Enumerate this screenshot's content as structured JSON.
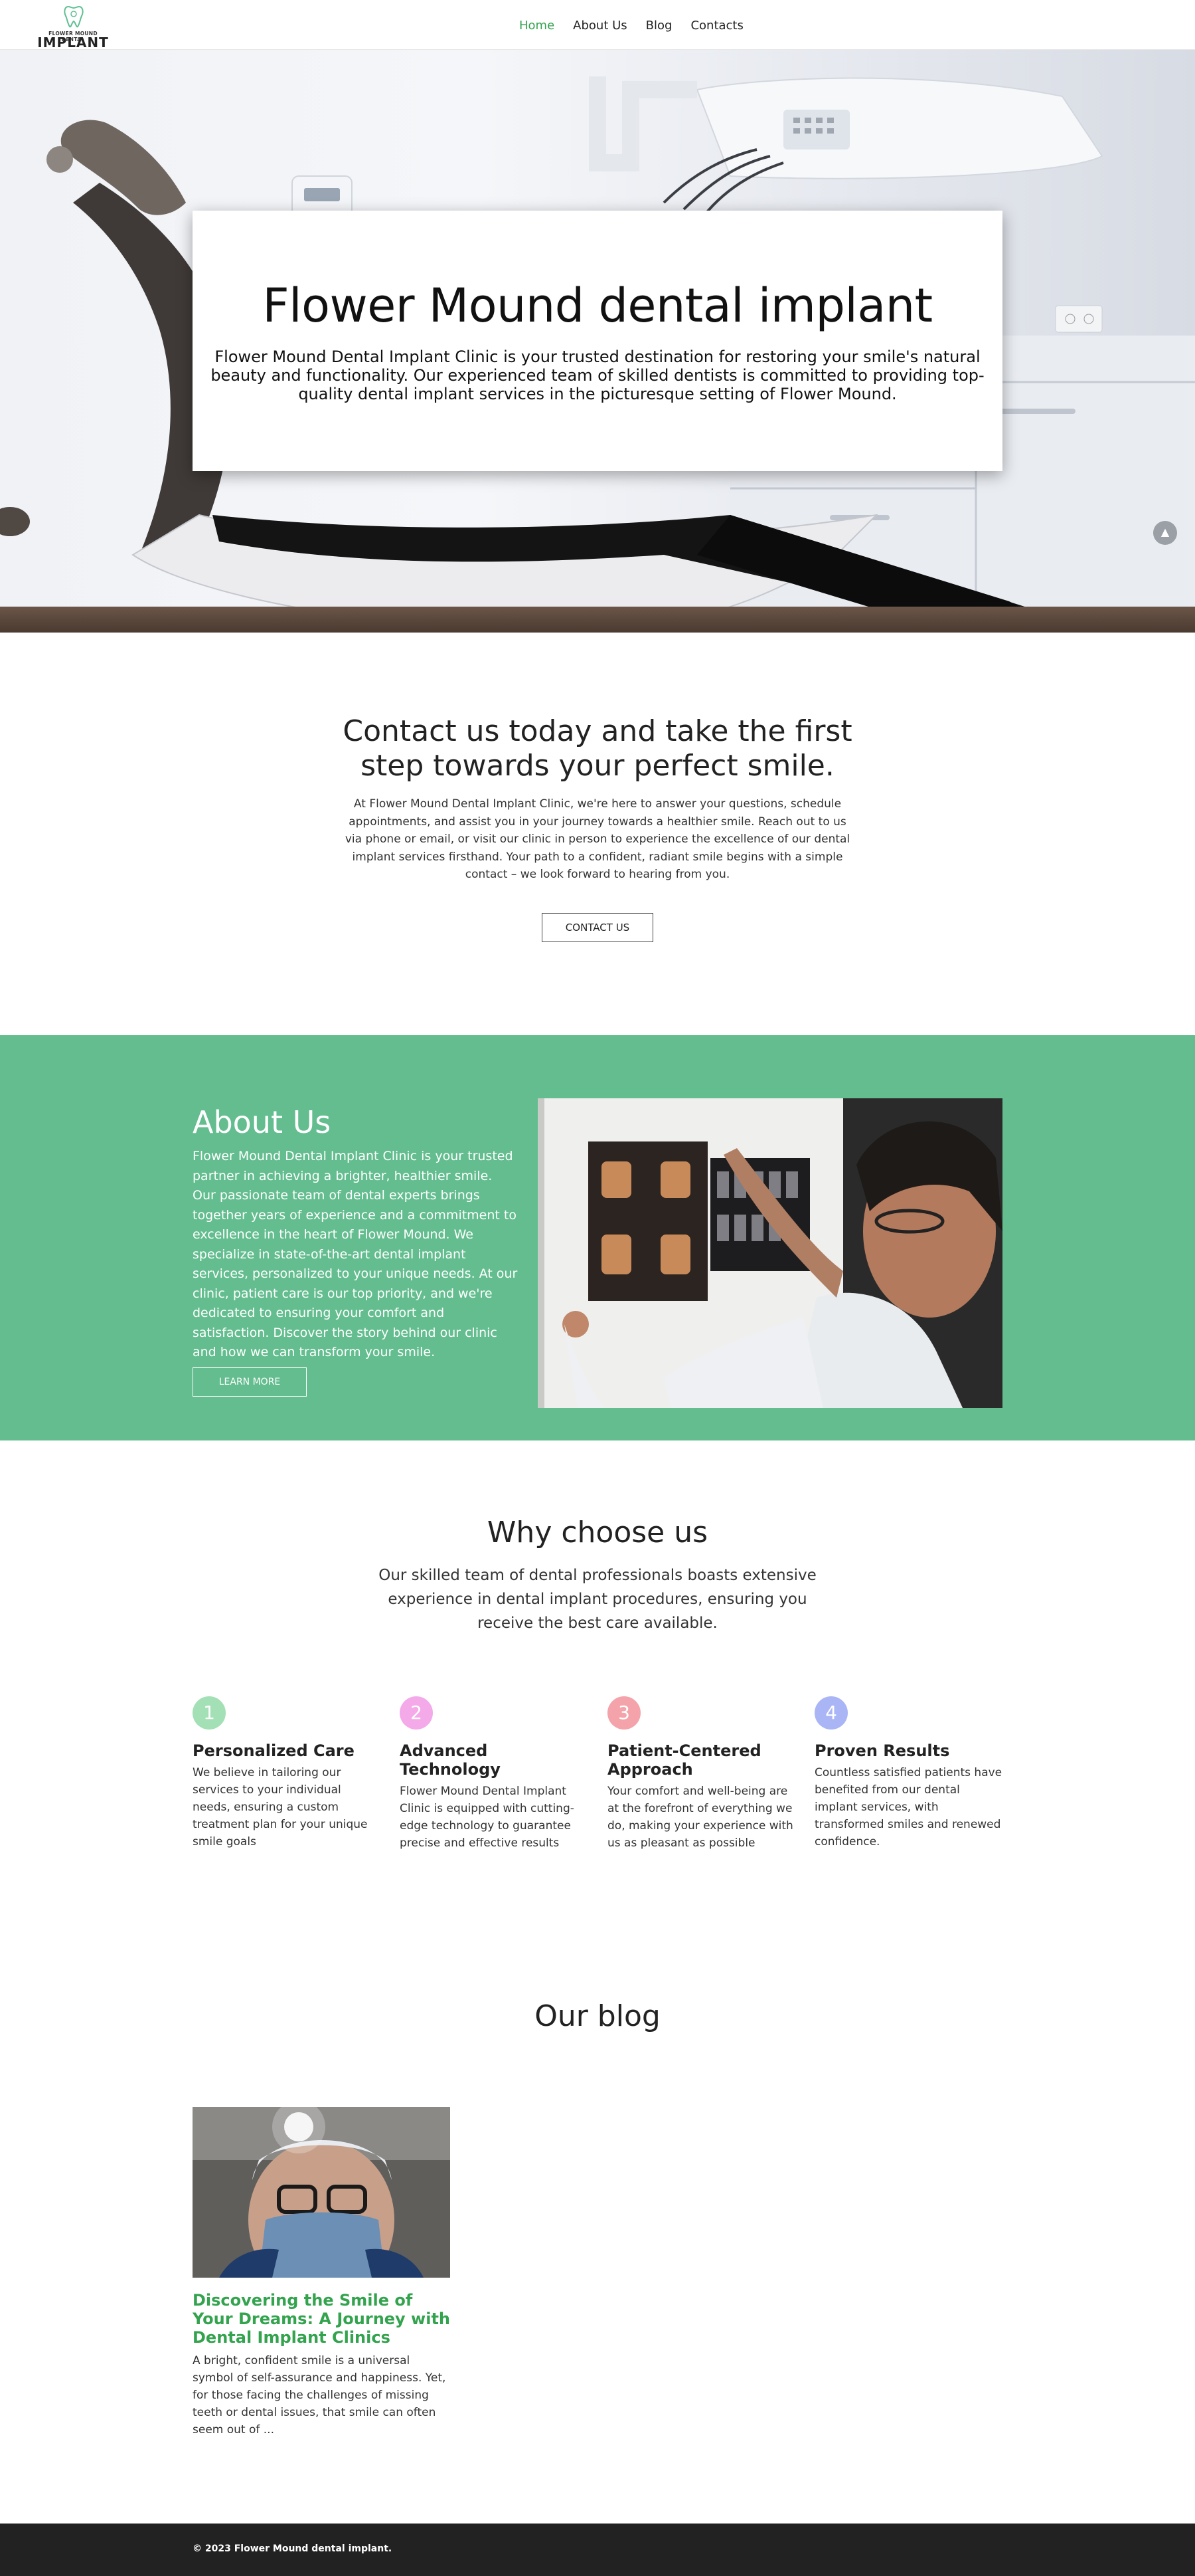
{
  "nav": {
    "logo_small": "FLOWER MOUND DENTAL",
    "logo_big": "IMPLANT",
    "items": [
      {
        "label": "Home"
      },
      {
        "label": "About Us"
      },
      {
        "label": "Blog"
      },
      {
        "label": "Contacts"
      }
    ],
    "active_color": "#33a34e"
  },
  "hero": {
    "title": "Flower Mound dental implant",
    "text": "Flower Mound Dental Implant Clinic is your trusted destination for restoring your smile's natural beauty and functionality. Our experienced team of skilled dentists is committed to providing top-quality dental implant services in the picturesque setting of Flower Mound."
  },
  "contact": {
    "title": "Contact us today and take the first step towards your perfect smile.",
    "text": "At Flower Mound Dental Implant Clinic, we're here to answer your questions, schedule appointments, and assist you in your journey towards a healthier smile. Reach out to us via phone or email, or visit our clinic in person to experience the excellence of our dental implant services firsthand. Your path to a confident, radiant smile begins with a simple contact – we look forward to hearing from you.",
    "button": "CONTACT US"
  },
  "about": {
    "title": "About Us",
    "text": "Flower Mound Dental Implant Clinic is your trusted partner in achieving a brighter, healthier smile. Our passionate team of dental experts brings together years of experience and a commitment to excellence in the heart of Flower Mound. We specialize in state-of-the-art dental implant services, personalized to your unique needs. At our clinic, patient care is our top priority, and we're dedicated to ensuring your comfort and satisfaction. Discover the story behind our clinic and how we can transform your smile.",
    "button": "LEARN MORE",
    "bg_color": "#63bd8f"
  },
  "why": {
    "title": "Why choose us",
    "subtitle": "Our skilled team of dental professionals boasts extensive experience in dental implant procedures, ensuring you receive the best care available.",
    "features": [
      {
        "num": "1",
        "title": "Personalized Care",
        "text": "We believe in tailoring our services to your individual needs, ensuring a custom treatment plan for your unique smile goals",
        "color": "#a3e0b5"
      },
      {
        "num": "2",
        "title": "Advanced Technology",
        "text": "Flower Mound Dental Implant Clinic is equipped with cutting-edge technology to guarantee precise and effective results",
        "color": "#f4a9e9"
      },
      {
        "num": "3",
        "title": "Patient-Centered Approach",
        "text": "Your comfort and well-being are at the forefront of everything we do, making your experience with us as pleasant as possible",
        "color": "#f3a3a9"
      },
      {
        "num": "4",
        "title": "Proven Results",
        "text": "Countless satisfied patients have benefited from our dental implant services, with transformed smiles and renewed confidence.",
        "color": "#a9b5f5"
      }
    ]
  },
  "blog": {
    "title": "Our blog",
    "posts": [
      {
        "title": "Discovering the Smile of Your Dreams: A Journey with Dental Implant Clinics",
        "excerpt": "A bright, confident smile is a universal symbol of self-assurance and happiness. Yet, for those facing the challenges of missing teeth or dental issues, that smile can often seem out of ..."
      }
    ]
  },
  "footer": {
    "text": "© 2023 Flower Mound dental implant."
  }
}
